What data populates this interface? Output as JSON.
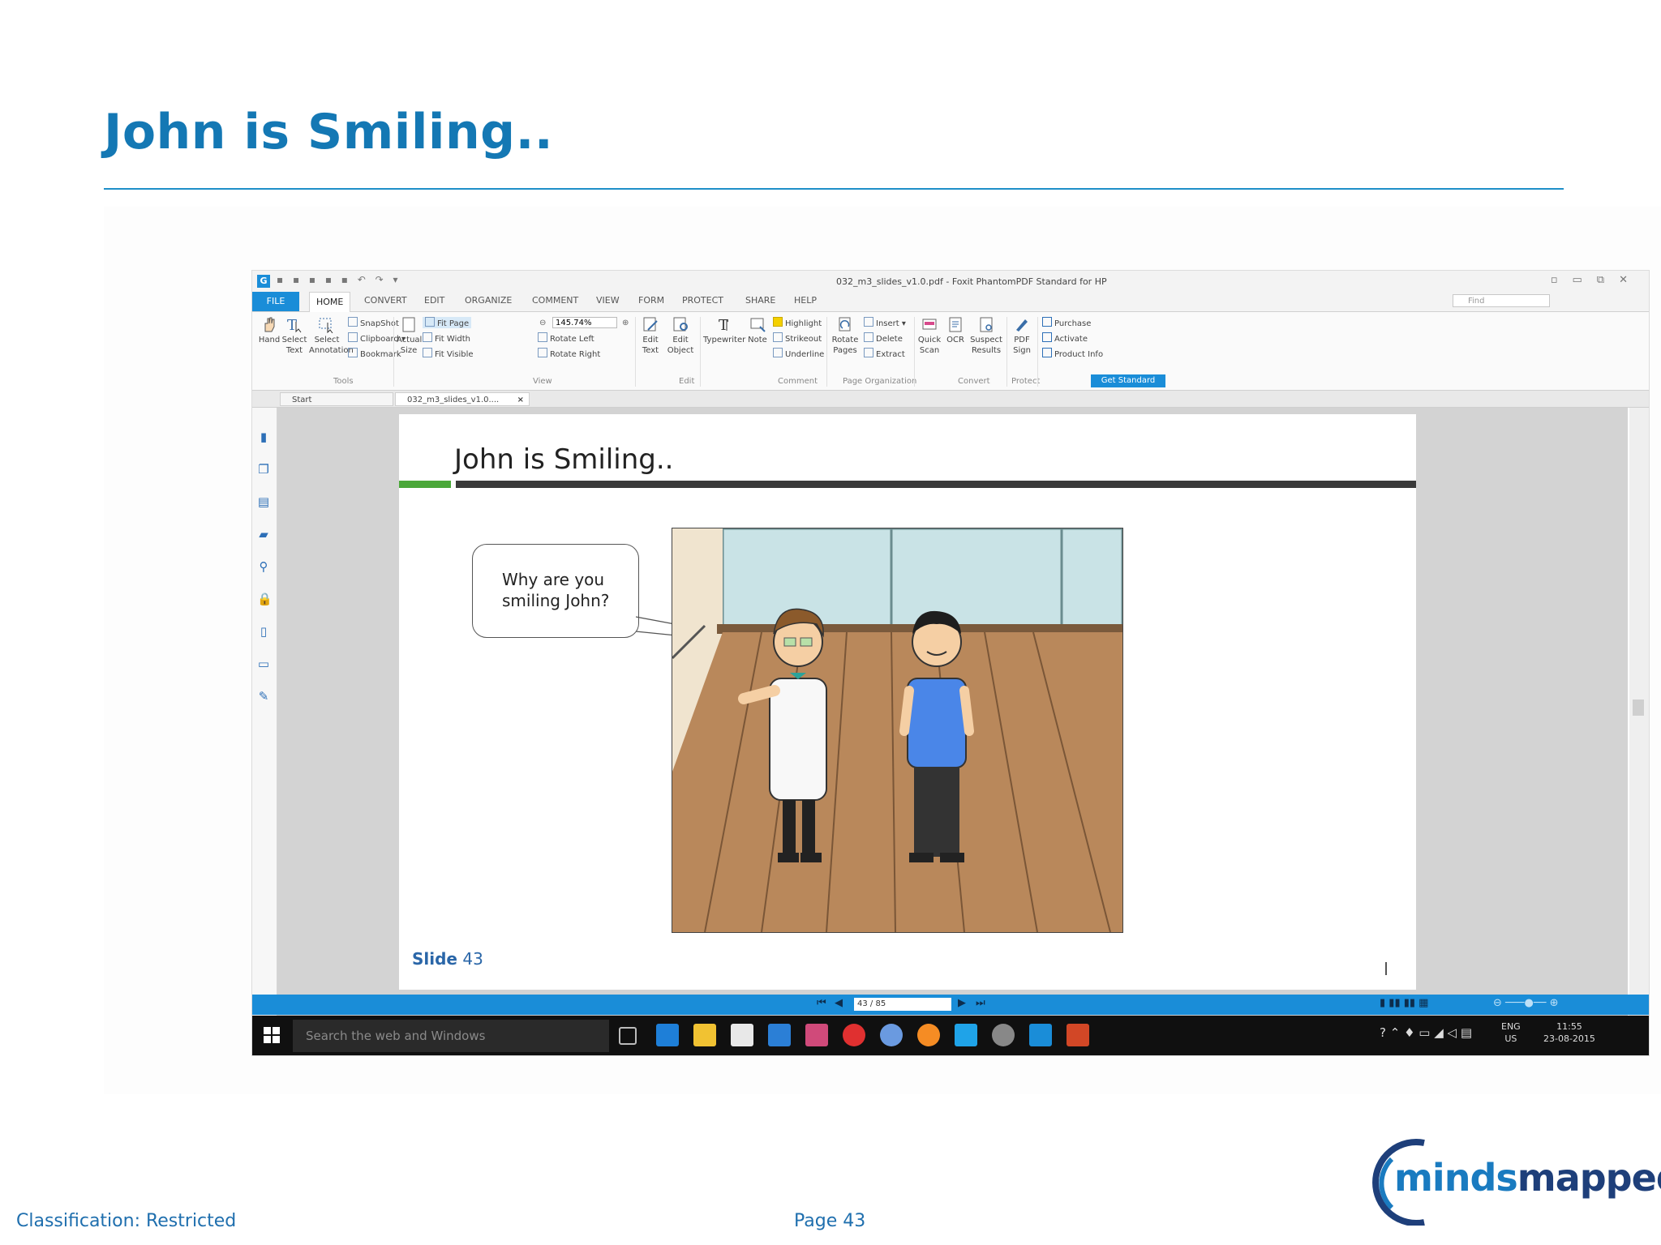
{
  "slide": {
    "title": "John is Smiling..",
    "classification": "Classification: Restricted",
    "page_label": "Page 43"
  },
  "logo": {
    "text_part1": "minds",
    "text_part2": "mapped",
    "color_part1": "#1a7bc0",
    "color_part2": "#1e3f7a"
  },
  "app": {
    "window_title": "032_m3_slides_v1.0.pdf - Foxit PhantomPDF Standard for HP",
    "tabs": [
      "FILE",
      "HOME",
      "CONVERT",
      "EDIT",
      "ORGANIZE",
      "COMMENT",
      "VIEW",
      "FORM",
      "PROTECT",
      "SHARE",
      "HELP"
    ],
    "find_placeholder": "Find",
    "ribbon": {
      "hand": "Hand",
      "select_text": "Select Text",
      "select_annotation": "Select Annotation",
      "snapshot": "SnapShot",
      "clipboard": "Clipboard",
      "bookmark": "Bookmark",
      "tools_group": "Tools",
      "actual_size": "Actual Size",
      "fit_page": "Fit Page",
      "fit_width": "Fit Width",
      "fit_visible": "Fit Visible",
      "zoom_value": "145.74%",
      "rotate_left": "Rotate Left",
      "rotate_right": "Rotate Right",
      "view_group": "View",
      "edit_text": "Edit Text",
      "edit_object": "Edit Object",
      "edit_group": "Edit",
      "typewriter": "Typewriter",
      "note": "Note",
      "highlight": "Highlight",
      "strikeout": "Strikeout",
      "underline": "Underline",
      "comment_group": "Comment",
      "rotate_pages": "Rotate Pages",
      "insert": "Insert",
      "delete": "Delete",
      "extract": "Extract",
      "page_org_group": "Page Organization",
      "quick_scan": "Quick Scan",
      "ocr": "OCR",
      "suspect_results": "Suspect Results",
      "convert_group": "Convert",
      "pdf_sign": "PDF Sign",
      "protect_group": "Protect",
      "purchase": "Purchase",
      "activate": "Activate",
      "product_info": "Product Info",
      "get_standard": "Get Standard"
    },
    "doc_tabs": {
      "start": "Start",
      "file": "032_m3_slides_v1.0...."
    },
    "document": {
      "title": "John is Smiling..",
      "bubble_line1": "Why are you",
      "bubble_line2": "smiling John?",
      "slide_word": "Slide",
      "slide_number": "43"
    },
    "nav": {
      "page_box": "43 / 85"
    },
    "taskbar": {
      "search_placeholder": "Search the web and Windows",
      "lang1": "ENG",
      "lang2": "US",
      "time": "11:55",
      "date": "23-08-2015"
    }
  }
}
